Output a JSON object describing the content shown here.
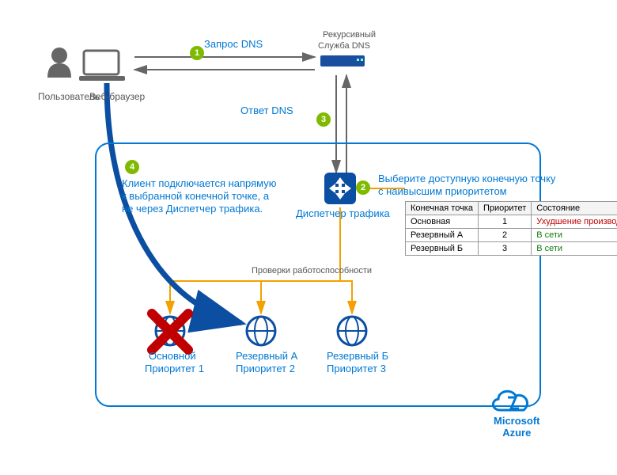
{
  "labels": {
    "user": "Пользователь",
    "browser": "Веб-браузер",
    "dns_recursive_1": "Рекурсивный",
    "dns_recursive_2": "Служба DNS",
    "dns_query": "Запрос DNS",
    "dns_response": "Ответ DNS",
    "traffic_manager": "Диспетчер трафика",
    "health_checks": "Проверки работоспособности",
    "azure": "Microsoft\nAzure",
    "step2_note_1": "Выберите доступную конечную точку",
    "step2_note_2": "с наивысшим приоритетом",
    "step4_note_1": "Клиент подключается напрямую",
    "step4_note_2": "к выбранной конечной точке, а",
    "step4_note_3": "не через Диспетчер трафика.",
    "ep1_name": "Основной",
    "ep1_pri": "Приоритет 1",
    "ep2_name": "Резервный А",
    "ep2_pri": "Приоритет 2",
    "ep3_name": "Резервный Б",
    "ep3_pri": "Приоритет 3"
  },
  "steps": {
    "s1": "1",
    "s2": "2",
    "s3": "3",
    "s4": "4"
  },
  "table": {
    "headers": {
      "endpoint": "Конечная точка",
      "priority": "Приоритет",
      "state": "Состояние"
    },
    "rows": [
      {
        "name": "Основная",
        "priority": "1",
        "state": "Ухудшение производительности",
        "cls": "bad"
      },
      {
        "name": "Резервный А",
        "priority": "2",
        "state": "В сети",
        "cls": "ok"
      },
      {
        "name": "Резервный Б",
        "priority": "3",
        "state": "В сети",
        "cls": "ok"
      }
    ]
  }
}
